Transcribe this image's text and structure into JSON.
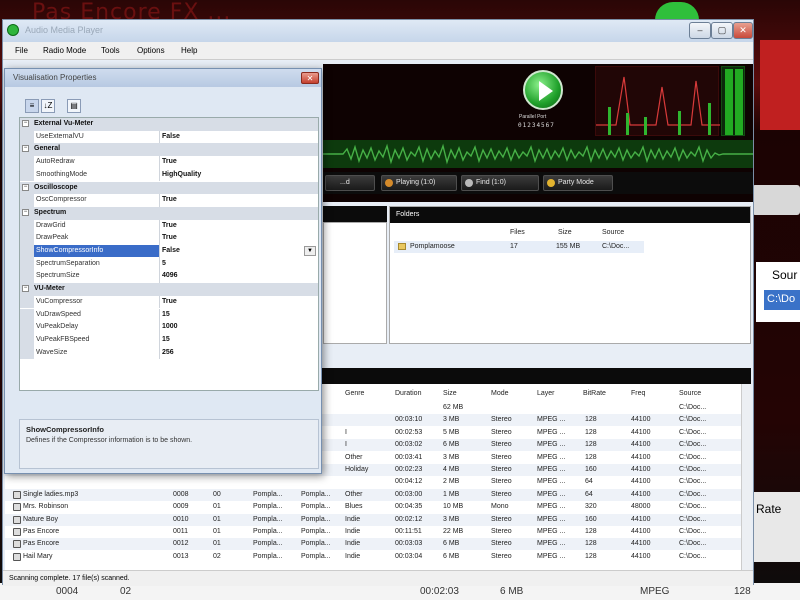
{
  "background": {
    "title": "Pas Encore  FX ...",
    "sour_label": "Sour",
    "sour_cell": "C:\\Do",
    "rate_label": "Rate",
    "bottom_a": "0004",
    "bottom_b": "02",
    "bottom_c": "00:02:03",
    "bottom_d": "6 MB",
    "bottom_e": "MPEG",
    "bottom_f": "128"
  },
  "main_window": {
    "title": "Audio Media Player",
    "window_buttons": {
      "minimize": "–",
      "maximize": "▢",
      "close": "✕"
    },
    "menu": [
      "File",
      "Radio Mode",
      "Tools",
      "Options",
      "Help"
    ],
    "player": {
      "param_label": "Parallel Port",
      "counter": "01234567"
    },
    "toolbar": [
      "...d",
      "Playing (1:0)",
      "Find (1:0)",
      "Party Mode"
    ],
    "folders": {
      "header": "Folders",
      "columns": [
        "Files",
        "Size",
        "Source"
      ],
      "rows": [
        {
          "name": "Pomplamoose",
          "files": "17",
          "size": "155 MB",
          "source": "C:\\Doc..."
        }
      ]
    },
    "tracks": {
      "columns": [
        "Genre",
        "Duration",
        "Size",
        "Mode",
        "Layer",
        "BitRate",
        "Freq",
        "Source"
      ],
      "rows": [
        {
          "name": "",
          "num": "",
          "disc": "",
          "artist": "",
          "album": "",
          "genre": "",
          "duration": "",
          "size": "62 MB",
          "mode": "",
          "layer": "",
          "bitrate": "",
          "freq": "",
          "source": "C:\\Doc..."
        },
        {
          "name": "",
          "num": "",
          "disc": "",
          "artist": "",
          "album": "",
          "genre": "",
          "duration": "00:03:10",
          "size": "3 MB",
          "mode": "Stereo",
          "layer": "MPEG ...",
          "bitrate": "128",
          "freq": "44100",
          "source": "C:\\Doc..."
        },
        {
          "name": "",
          "num": "",
          "disc": "",
          "artist": "",
          "album": "",
          "genre": "I",
          "duration": "00:02:53",
          "size": "5 MB",
          "mode": "Stereo",
          "layer": "MPEG ...",
          "bitrate": "128",
          "freq": "44100",
          "source": "C:\\Doc..."
        },
        {
          "name": "",
          "num": "",
          "disc": "",
          "artist": "",
          "album": "",
          "genre": "I",
          "duration": "00:03:02",
          "size": "6 MB",
          "mode": "Stereo",
          "layer": "MPEG ...",
          "bitrate": "128",
          "freq": "44100",
          "source": "C:\\Doc..."
        },
        {
          "name": "",
          "num": "",
          "disc": "",
          "artist": "",
          "album": "",
          "genre": "Other",
          "duration": "00:03:41",
          "size": "3 MB",
          "mode": "Stereo",
          "layer": "MPEG ...",
          "bitrate": "128",
          "freq": "44100",
          "source": "C:\\Doc..."
        },
        {
          "name": "",
          "num": "",
          "disc": "",
          "artist": "",
          "album": "",
          "genre": "Holiday",
          "duration": "00:02:23",
          "size": "4 MB",
          "mode": "Stereo",
          "layer": "MPEG ...",
          "bitrate": "160",
          "freq": "44100",
          "source": "C:\\Doc..."
        },
        {
          "name": "",
          "num": "",
          "disc": "",
          "artist": "",
          "album": "",
          "genre": "",
          "duration": "00:04:12",
          "size": "2 MB",
          "mode": "Stereo",
          "layer": "MPEG ...",
          "bitrate": "64",
          "freq": "44100",
          "source": "C:\\Doc..."
        },
        {
          "name": "Single ladies.mp3",
          "num": "0008",
          "disc": "00",
          "artist": "Pompla...",
          "album": "Pompla...",
          "genre": "Other",
          "duration": "00:03:00",
          "size": "1 MB",
          "mode": "Stereo",
          "layer": "MPEG ...",
          "bitrate": "64",
          "freq": "44100",
          "source": "C:\\Doc..."
        },
        {
          "name": "Mrs. Robinson",
          "num": "0009",
          "disc": "01",
          "artist": "Pompla...",
          "album": "Pompla...",
          "genre": "Blues",
          "duration": "00:04:35",
          "size": "10 MB",
          "mode": "Mono",
          "layer": "MPEG ...",
          "bitrate": "320",
          "freq": "48000",
          "source": "C:\\Doc..."
        },
        {
          "name": "Nature Boy",
          "num": "0010",
          "disc": "01",
          "artist": "Pompla...",
          "album": "Pompla...",
          "genre": "Indie",
          "duration": "00:02:12",
          "size": "3 MB",
          "mode": "Stereo",
          "layer": "MPEG ...",
          "bitrate": "160",
          "freq": "44100",
          "source": "C:\\Doc..."
        },
        {
          "name": "Pas Encore",
          "num": "0011",
          "disc": "01",
          "artist": "Pompla...",
          "album": "Pompla...",
          "genre": "Indie",
          "duration": "00:11:51",
          "size": "22 MB",
          "mode": "Stereo",
          "layer": "MPEG ...",
          "bitrate": "128",
          "freq": "44100",
          "source": "C:\\Doc..."
        },
        {
          "name": "Pas Encore",
          "num": "0012",
          "disc": "01",
          "artist": "Pompla...",
          "album": "Pompla...",
          "genre": "Indie",
          "duration": "00:03:03",
          "size": "6 MB",
          "mode": "Stereo",
          "layer": "MPEG ...",
          "bitrate": "128",
          "freq": "44100",
          "source": "C:\\Doc..."
        },
        {
          "name": "Hail Mary",
          "num": "0013",
          "disc": "02",
          "artist": "Pompla...",
          "album": "Pompla...",
          "genre": "Indie",
          "duration": "00:03:04",
          "size": "6 MB",
          "mode": "Stereo",
          "layer": "MPEG ...",
          "bitrate": "128",
          "freq": "44100",
          "source": "C:\\Doc..."
        }
      ]
    },
    "status": "Scanning complete.  17 file(s) scanned."
  },
  "dialog": {
    "title": "Visualisation Properties",
    "close": "✕",
    "toolbar": [
      "≡",
      "↓Z",
      "▤"
    ],
    "grid": [
      {
        "type": "category",
        "name": "External Vu-Meter"
      },
      {
        "type": "prop",
        "name": "UseExternalVU",
        "value": "False"
      },
      {
        "type": "category",
        "name": "General"
      },
      {
        "type": "prop",
        "name": "AutoRedraw",
        "value": "True"
      },
      {
        "type": "prop",
        "name": "SmoothingMode",
        "value": "HighQuality"
      },
      {
        "type": "category",
        "name": "Oscilloscope"
      },
      {
        "type": "prop",
        "name": "OscCompressor",
        "value": "True"
      },
      {
        "type": "category",
        "name": "Spectrum"
      },
      {
        "type": "prop",
        "name": "DrawGrid",
        "value": "True"
      },
      {
        "type": "prop",
        "name": "DrawPeak",
        "value": "True"
      },
      {
        "type": "prop",
        "name": "ShowCompressorInfo",
        "value": "False",
        "selected": true
      },
      {
        "type": "prop",
        "name": "SpectrumSeparation",
        "value": "5"
      },
      {
        "type": "prop",
        "name": "SpectrumSize",
        "value": "4096"
      },
      {
        "type": "category",
        "name": "VU-Meter"
      },
      {
        "type": "prop",
        "name": "VuCompressor",
        "value": "True"
      },
      {
        "type": "prop",
        "name": "VuDrawSpeed",
        "value": "15"
      },
      {
        "type": "prop",
        "name": "VuPeakDelay",
        "value": "1000"
      },
      {
        "type": "prop",
        "name": "VuPeakFBSpeed",
        "value": "15"
      },
      {
        "type": "prop",
        "name": "WaveSize",
        "value": "256"
      }
    ],
    "dropdown_arrow": "▼",
    "description": {
      "title": "ShowCompressorInfo",
      "text": "Defines if the Compressor information is to be shown."
    }
  },
  "colors": {
    "accent": "#3a6cc8",
    "player_bg": "#0e0202",
    "waveform": "#2d8a2d",
    "spectrum_line": "#e04040"
  }
}
